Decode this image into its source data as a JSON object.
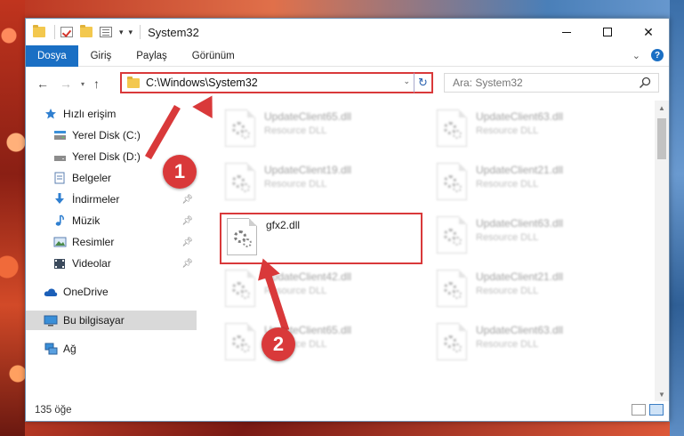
{
  "window": {
    "title": "System32",
    "controls": {
      "minimize_icon": "minimize-icon",
      "maximize_icon": "maximize-icon",
      "close_label": "✕"
    }
  },
  "ribbon": {
    "tabs": [
      {
        "label": "Dosya",
        "active": true
      },
      {
        "label": "Giriş"
      },
      {
        "label": "Paylaş"
      },
      {
        "label": "Görünüm"
      }
    ],
    "help_label": "?"
  },
  "navbar": {
    "back_icon": "arrow-left-icon",
    "forward_icon": "arrow-right-icon",
    "up_icon": "arrow-up-icon",
    "address": "C:\\Windows\\System32",
    "search_placeholder": "Ara: System32"
  },
  "sidebar": {
    "items": [
      {
        "label": "Hızlı erişim",
        "icon": "star-icon"
      },
      {
        "label": "Yerel Disk (C:)",
        "icon": "drive-icon"
      },
      {
        "label": "Yerel Disk (D:)",
        "icon": "drive-icon"
      },
      {
        "label": "Belgeler",
        "icon": "document-icon"
      },
      {
        "label": "İndirmeler",
        "icon": "download-icon",
        "pinned": true
      },
      {
        "label": "Müzik",
        "icon": "music-icon",
        "pinned": true
      },
      {
        "label": "Resimler",
        "icon": "pictures-icon",
        "pinned": true
      },
      {
        "label": "Videolar",
        "icon": "video-icon",
        "pinned": true
      },
      {
        "label": "OneDrive",
        "icon": "cloud-icon"
      },
      {
        "label": "Bu bilgisayar",
        "icon": "computer-icon",
        "selected": true
      },
      {
        "label": "Ağ",
        "icon": "network-icon"
      }
    ]
  },
  "files": [
    {
      "name": "UpdateClient65.dll",
      "type": "Resource DLL"
    },
    {
      "name": "UpdateClient63.dll",
      "type": "Resource DLL"
    },
    {
      "name": "UpdateClient19.dll",
      "type": "Resource DLL"
    },
    {
      "name": "UpdateClient21.dll",
      "type": "Resource DLL"
    },
    {
      "name": "gfx2.dll",
      "type": ""
    },
    {
      "name": "UpdateClient63.dll",
      "type": "Resource DLL"
    },
    {
      "name": "UpdateClient42.dll",
      "type": "Resource DLL"
    },
    {
      "name": "UpdateClient21.dll",
      "type": "Resource DLL"
    },
    {
      "name": "UpdateClient65.dll",
      "type": "Resource DLL"
    },
    {
      "name": "UpdateClient63.dll",
      "type": "Resource DLL"
    }
  ],
  "status": {
    "count_text": "135 öğe"
  },
  "annotations": {
    "step1": "1",
    "step2": "2"
  },
  "colors": {
    "accent": "#1a6fc4",
    "highlight_red": "#d9393a",
    "folder": "#f3c84e"
  }
}
